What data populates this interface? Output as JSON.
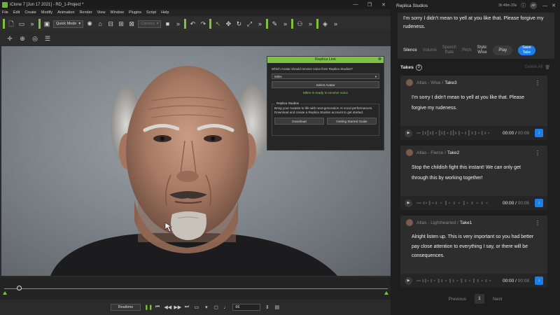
{
  "iclone": {
    "title": "iClone 7 [Jun 17 2021] - RD_1-Project *",
    "menu": [
      "File",
      "Edit",
      "Create",
      "Modify",
      "Animation",
      "Render",
      "View",
      "Window",
      "Plugins",
      "Script",
      "Help"
    ],
    "quick_mode": "Quick Mode",
    "camera_dd": "Camera",
    "replica_link": {
      "header": "Replica Link",
      "question": "Which Avatar should receive voice from Replica Studios?",
      "avatar": "Miles",
      "select_btn": "Select Avatar",
      "status": "Miles is ready to receive voice",
      "box_title": "Replica Studios",
      "box_text": "Bring your Avatars to life with next-generation AI vocal performances. Download and create a Replica Studios account to get started.",
      "download_btn": "Download",
      "guide_btn": "Getting Started Guide"
    },
    "playbar": {
      "realtime": "Realtime",
      "frame": "66"
    }
  },
  "replica": {
    "title": "Replica Studios",
    "meta": "3h 48m 29s",
    "avatar_initials": "AF",
    "editor_text": "I'm sorry I didn't mean to yell at you like that. Please forgive my rudeness.",
    "controls": {
      "silence": "Silence",
      "volume": "Volume",
      "speech_rate_1": "Speech",
      "speech_rate_2": "Rate",
      "pitch": "Pitch",
      "style_1": "Style:",
      "style_2": "Wise",
      "play": "Play",
      "save_1": "Save",
      "save_2": "Take"
    },
    "takes_label": "Takes",
    "takes_count": "3",
    "delete_all": "Delete All",
    "takes": [
      {
        "voice": "Atlas - Wise /",
        "take": "Take3",
        "text": "I'm sorry I didn't mean to yell at you like that. Please forgive my rudeness.",
        "time": "00:00 /",
        "duration": "00:06"
      },
      {
        "voice": "Atlas - Fierce /",
        "take": "Take2",
        "text": "Stop the childish fight this instant! We can only get through this by working together!",
        "time": "00:00 /",
        "duration": "00:06"
      },
      {
        "voice": "Atlas - Lighthearted /",
        "take": "Take1",
        "text": "Alright listen up. This is very important so you had better pay close attention to everything I say, or there will be consequences.",
        "time": "00:00 /",
        "duration": "00:08"
      }
    ],
    "pager": {
      "prev": "Previous",
      "page": "1",
      "next": "Next"
    }
  }
}
